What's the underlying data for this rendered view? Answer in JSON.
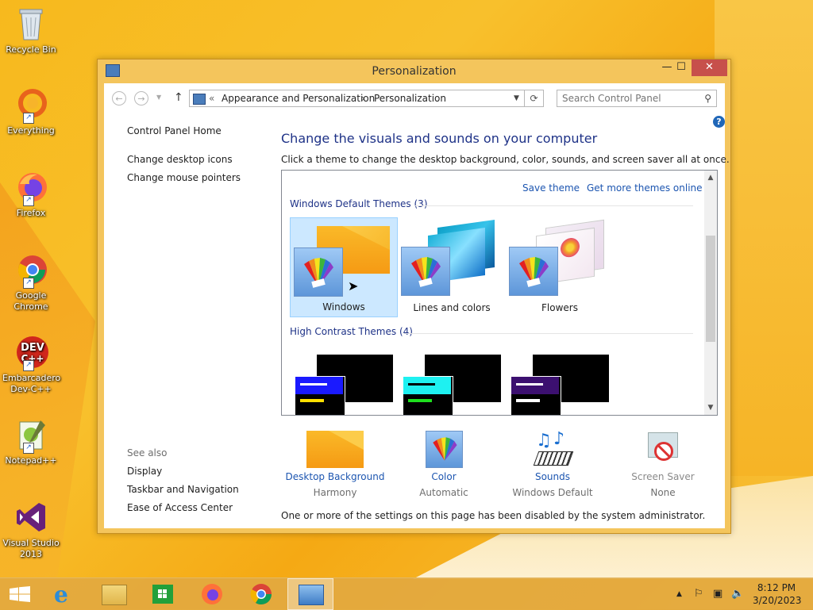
{
  "desktop_icons": [
    {
      "name": "Recycle Bin"
    },
    {
      "name": "Everything"
    },
    {
      "name": "Firefox"
    },
    {
      "name": "Google Chrome"
    },
    {
      "name": "Embarcadero Dev-C++"
    },
    {
      "name": "Notepad++"
    },
    {
      "name": "Visual Studio 2013"
    }
  ],
  "window": {
    "title": "Personalization",
    "buttons": {
      "minimize": "—",
      "maximize": "☐",
      "close": "✕"
    }
  },
  "nav": {
    "back": "←",
    "forward": "→",
    "up": "↑",
    "chevron": "«",
    "breadcrumb": [
      "Appearance and Personalization",
      "Personalization"
    ],
    "separator": "›",
    "refresh": "⟳",
    "search_placeholder": "Search Control Panel"
  },
  "left_pane": {
    "home": "Control Panel Home",
    "links": [
      "Change desktop icons",
      "Change mouse pointers"
    ],
    "see_also_label": "See also",
    "see_also": [
      "Display",
      "Taskbar and Navigation",
      "Ease of Access Center"
    ]
  },
  "main": {
    "heading": "Change the visuals and sounds on your computer",
    "subtext": "Click a theme to change the desktop background, color, sounds, and screen saver all at once.",
    "help": "?",
    "save_theme": "Save theme",
    "get_more": "Get more themes online",
    "default_group": "Windows Default Themes (3)",
    "default_themes": [
      "Windows",
      "Lines and colors",
      "Flowers"
    ],
    "contrast_group": "High Contrast Themes (4)"
  },
  "bottom": [
    {
      "label": "Desktop Background",
      "value": "Harmony"
    },
    {
      "label": "Color",
      "value": "Automatic"
    },
    {
      "label": "Sounds",
      "value": "Windows Default"
    },
    {
      "label": "Screen Saver",
      "value": "None"
    }
  ],
  "disabled_message": "One or more of the settings on this page has been disabled by the system administrator.",
  "clock": {
    "time": "8:12 PM",
    "date": "3/20/2023"
  }
}
